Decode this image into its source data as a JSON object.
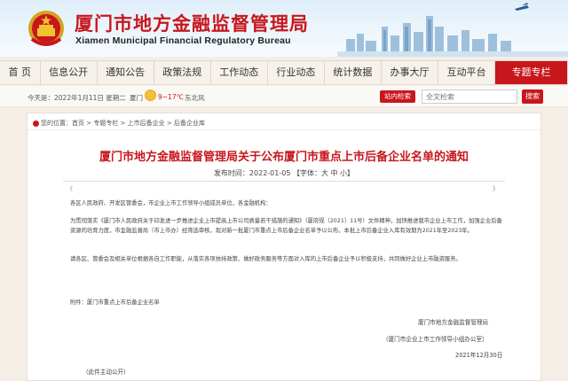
{
  "header": {
    "site_title": "厦门市地方金融监督管理局",
    "site_subtitle": "Xiamen Municipal Financial Regulatory Bureau"
  },
  "nav": {
    "items": [
      "首 页",
      "信息公开",
      "通知公告",
      "政策法规",
      "工作动态",
      "行业动态",
      "统计数据",
      "办事大厅",
      "互动平台",
      "专题专栏"
    ],
    "active": "专题专栏"
  },
  "info_bar": {
    "date": "今天是：2022年1月11日 星期二",
    "weather_city": "厦门",
    "weather_icon": "sun-icon",
    "weather_temp": "9~17℃",
    "weather_wind": "东北风",
    "site_search_label": "站内检索",
    "search_placeholder": "全文检索",
    "search_button": "搜索"
  },
  "breadcrumb": "您的位置：首页 > 专题专栏 > 上市后备企业 > 后备企业库",
  "article": {
    "title": "厦门市地方金融监督管理局关于公布厦门市重点上市后备企业名单的通知",
    "meta": "发布时间：2022-01-05 【字体：大 中 小】",
    "pager_left": "《",
    "pager_right": "》",
    "salutation": "各区人民政府、开发区管委会，市企业上市工作领导小组成员单位，各金融机构：",
    "para1": "为贯彻落实《厦门市人民政府关于印发进一步推进企业上市提高上市公司质量若干措施的通知》（厦府规〔2021〕11号）文件精神，加快推进我市企业上市工作，加强企业后备资源的培育力度，市金融监督局（市上市办）经筛选审核，现对新一批厦门市重点上市后备企业名单予以公布，本批上市后备企业入库有效期为2021年至2023年。",
    "para2": "请各区、管委会及相关单位根据各自工作职能，从落实各项扶持政策、做好政务服务等方面对入库的上市后备企业予以积极支持，共同做好企业上市融资服务。",
    "attachment": "附件：厦门市重点上市后备企业名单",
    "signature_org": "厦门市地方金融监督管理局",
    "signature_office": "（厦门市企业上市工作领导小组办公室）",
    "signature_date": "2021年12月30日",
    "footnote": "（此件主动公开）"
  },
  "colors": {
    "brand_red": "#c8161d"
  }
}
